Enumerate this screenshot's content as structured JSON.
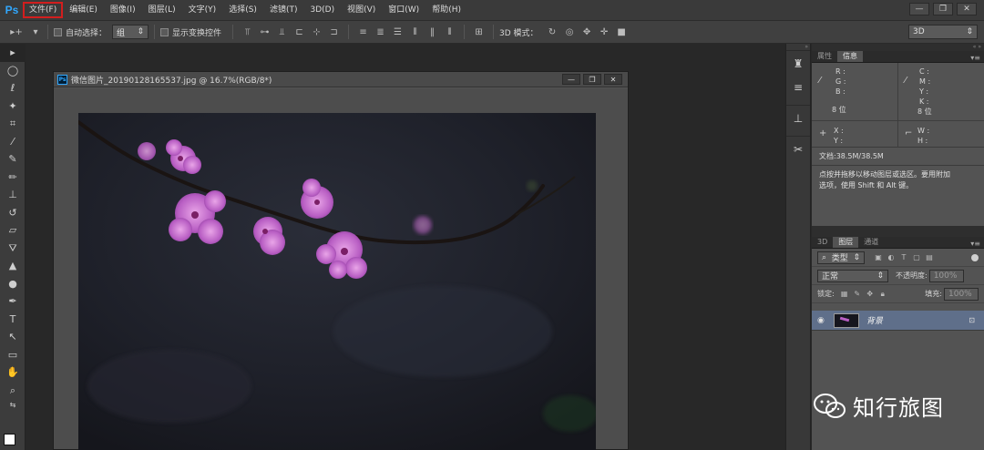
{
  "app": {
    "logo": "Ps"
  },
  "menubar": {
    "items": [
      "文件(F)",
      "编辑(E)",
      "图像(I)",
      "图层(L)",
      "文字(Y)",
      "选择(S)",
      "滤镜(T)",
      "3D(D)",
      "视图(V)",
      "窗口(W)",
      "帮助(H)"
    ],
    "active_item": "文件(F)",
    "highlight_color": "#d21e1e"
  },
  "window_controls": {
    "minimize": "—",
    "restore": "❐",
    "close": "✕"
  },
  "options_bar": {
    "auto_select_label": "自动选择：",
    "auto_select_value": "组",
    "show_transform_label": "显示变换控件",
    "mode_3d_label": "3D 模式：",
    "workspace_value": "3D"
  },
  "document": {
    "title": "微信图片_20190128165537.jpg @ 16.7%(RGB/8*)",
    "icon": "Ps"
  },
  "panels": {
    "top_tabs": [
      "属性",
      "信息"
    ],
    "active_top_tab": "信息",
    "info": {
      "rgb_labels": [
        "R :",
        "G :",
        "B :"
      ],
      "cmyk_labels": [
        "C :",
        "M :",
        "Y :",
        "K :"
      ],
      "bit_depth_left": "8 位",
      "bit_depth_right": "8 位",
      "xy_labels": [
        "X :",
        "Y :"
      ],
      "wh_labels": [
        "W :",
        "H :"
      ],
      "doc_size": "文档:38.5M/38.5M",
      "hint_line1": "点按并拖移以移动图层或选区。要用附加",
      "hint_line2": "选项，使用 Shift 和 Alt 键。"
    },
    "layer_tabs": [
      "3D",
      "图层",
      "通道"
    ],
    "active_layer_tab": "图层",
    "filter_kind": "类型",
    "blend_mode": "正常",
    "opacity_label": "不透明度:",
    "opacity_value": "100%",
    "lock_label": "锁定:",
    "fill_label": "填充:",
    "fill_value": "100%",
    "layer_name": "背景"
  },
  "watermark": {
    "text": "知行旅图"
  },
  "colors": {
    "accent": "#31a8ff",
    "layer_selected": "#5f6f8a"
  }
}
